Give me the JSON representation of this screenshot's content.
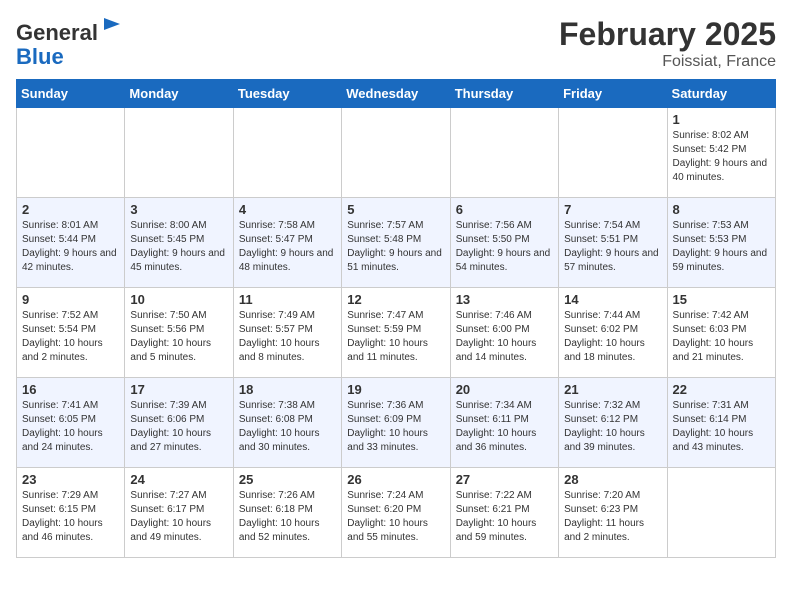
{
  "header": {
    "logo_line1": "General",
    "logo_line2": "Blue",
    "month_title": "February 2025",
    "location": "Foissiat, France"
  },
  "weekdays": [
    "Sunday",
    "Monday",
    "Tuesday",
    "Wednesday",
    "Thursday",
    "Friday",
    "Saturday"
  ],
  "weeks": [
    [
      {
        "day": "",
        "info": ""
      },
      {
        "day": "",
        "info": ""
      },
      {
        "day": "",
        "info": ""
      },
      {
        "day": "",
        "info": ""
      },
      {
        "day": "",
        "info": ""
      },
      {
        "day": "",
        "info": ""
      },
      {
        "day": "1",
        "info": "Sunrise: 8:02 AM\nSunset: 5:42 PM\nDaylight: 9 hours and 40 minutes."
      }
    ],
    [
      {
        "day": "2",
        "info": "Sunrise: 8:01 AM\nSunset: 5:44 PM\nDaylight: 9 hours and 42 minutes."
      },
      {
        "day": "3",
        "info": "Sunrise: 8:00 AM\nSunset: 5:45 PM\nDaylight: 9 hours and 45 minutes."
      },
      {
        "day": "4",
        "info": "Sunrise: 7:58 AM\nSunset: 5:47 PM\nDaylight: 9 hours and 48 minutes."
      },
      {
        "day": "5",
        "info": "Sunrise: 7:57 AM\nSunset: 5:48 PM\nDaylight: 9 hours and 51 minutes."
      },
      {
        "day": "6",
        "info": "Sunrise: 7:56 AM\nSunset: 5:50 PM\nDaylight: 9 hours and 54 minutes."
      },
      {
        "day": "7",
        "info": "Sunrise: 7:54 AM\nSunset: 5:51 PM\nDaylight: 9 hours and 57 minutes."
      },
      {
        "day": "8",
        "info": "Sunrise: 7:53 AM\nSunset: 5:53 PM\nDaylight: 9 hours and 59 minutes."
      }
    ],
    [
      {
        "day": "9",
        "info": "Sunrise: 7:52 AM\nSunset: 5:54 PM\nDaylight: 10 hours and 2 minutes."
      },
      {
        "day": "10",
        "info": "Sunrise: 7:50 AM\nSunset: 5:56 PM\nDaylight: 10 hours and 5 minutes."
      },
      {
        "day": "11",
        "info": "Sunrise: 7:49 AM\nSunset: 5:57 PM\nDaylight: 10 hours and 8 minutes."
      },
      {
        "day": "12",
        "info": "Sunrise: 7:47 AM\nSunset: 5:59 PM\nDaylight: 10 hours and 11 minutes."
      },
      {
        "day": "13",
        "info": "Sunrise: 7:46 AM\nSunset: 6:00 PM\nDaylight: 10 hours and 14 minutes."
      },
      {
        "day": "14",
        "info": "Sunrise: 7:44 AM\nSunset: 6:02 PM\nDaylight: 10 hours and 18 minutes."
      },
      {
        "day": "15",
        "info": "Sunrise: 7:42 AM\nSunset: 6:03 PM\nDaylight: 10 hours and 21 minutes."
      }
    ],
    [
      {
        "day": "16",
        "info": "Sunrise: 7:41 AM\nSunset: 6:05 PM\nDaylight: 10 hours and 24 minutes."
      },
      {
        "day": "17",
        "info": "Sunrise: 7:39 AM\nSunset: 6:06 PM\nDaylight: 10 hours and 27 minutes."
      },
      {
        "day": "18",
        "info": "Sunrise: 7:38 AM\nSunset: 6:08 PM\nDaylight: 10 hours and 30 minutes."
      },
      {
        "day": "19",
        "info": "Sunrise: 7:36 AM\nSunset: 6:09 PM\nDaylight: 10 hours and 33 minutes."
      },
      {
        "day": "20",
        "info": "Sunrise: 7:34 AM\nSunset: 6:11 PM\nDaylight: 10 hours and 36 minutes."
      },
      {
        "day": "21",
        "info": "Sunrise: 7:32 AM\nSunset: 6:12 PM\nDaylight: 10 hours and 39 minutes."
      },
      {
        "day": "22",
        "info": "Sunrise: 7:31 AM\nSunset: 6:14 PM\nDaylight: 10 hours and 43 minutes."
      }
    ],
    [
      {
        "day": "23",
        "info": "Sunrise: 7:29 AM\nSunset: 6:15 PM\nDaylight: 10 hours and 46 minutes."
      },
      {
        "day": "24",
        "info": "Sunrise: 7:27 AM\nSunset: 6:17 PM\nDaylight: 10 hours and 49 minutes."
      },
      {
        "day": "25",
        "info": "Sunrise: 7:26 AM\nSunset: 6:18 PM\nDaylight: 10 hours and 52 minutes."
      },
      {
        "day": "26",
        "info": "Sunrise: 7:24 AM\nSunset: 6:20 PM\nDaylight: 10 hours and 55 minutes."
      },
      {
        "day": "27",
        "info": "Sunrise: 7:22 AM\nSunset: 6:21 PM\nDaylight: 10 hours and 59 minutes."
      },
      {
        "day": "28",
        "info": "Sunrise: 7:20 AM\nSunset: 6:23 PM\nDaylight: 11 hours and 2 minutes."
      },
      {
        "day": "",
        "info": ""
      }
    ]
  ]
}
